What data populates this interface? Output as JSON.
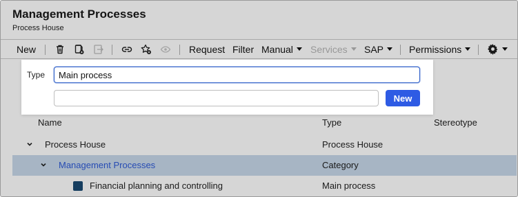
{
  "header": {
    "title": "Management Processes",
    "subtitle": "Process House"
  },
  "toolbar": {
    "new_label": "New",
    "request_label": "Request",
    "filter_label": "Filter",
    "manual_label": "Manual",
    "services_label": "Services",
    "sap_label": "SAP",
    "permissions_label": "Permissions",
    "icons": [
      "trash-icon",
      "copy-doc-icon",
      "move-icon",
      "link-icon",
      "star-add-icon",
      "eye-icon",
      "gear-icon"
    ]
  },
  "popup": {
    "type_label": "Type",
    "type_value": "Main process",
    "second_value": "",
    "new_button": "New",
    "accent_color": "#2e5be4"
  },
  "table": {
    "columns": [
      "Name",
      "Type",
      "Stereotype"
    ],
    "rows": [
      {
        "name": "Process House",
        "type": "Process House",
        "stereotype": ""
      },
      {
        "name": "Management Processes",
        "type": "Category",
        "stereotype": ""
      },
      {
        "name": "Financial planning and controlling",
        "type": "Main process",
        "stereotype": ""
      }
    ],
    "selected_color": "#c7d8ea",
    "link_color": "#2e5ad6"
  }
}
